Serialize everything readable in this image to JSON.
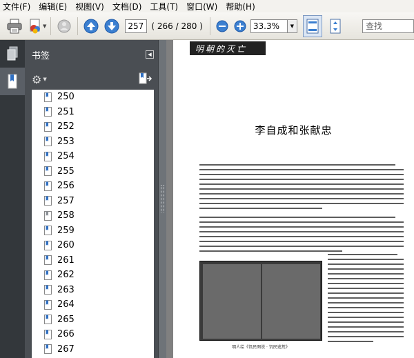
{
  "menu": [
    "文件(F)",
    "编辑(E)",
    "视图(V)",
    "文档(D)",
    "工具(T)",
    "窗口(W)",
    "帮助(H)"
  ],
  "toolbar": {
    "print_icon": "printer-icon",
    "current_page": "257",
    "page_count": "( 266 / 280 )",
    "zoom": "33.3%",
    "search_placeholder": "查找"
  },
  "bookmarks_panel": {
    "title": "书签",
    "items": [
      "250",
      "251",
      "252",
      "253",
      "254",
      "255",
      "256",
      "257",
      "258",
      "259",
      "260",
      "261",
      "262",
      "263",
      "264",
      "265",
      "266",
      "267"
    ],
    "selected_index": 8
  },
  "document": {
    "header_band": "明朝的灭亡",
    "chapter_title": "李自成和张献忠",
    "caption": "明人绘《饥民图说 · 饥民逃荒》"
  },
  "colors": {
    "accent": "#2f6fc2",
    "panel_bg": "#4a4e53",
    "nav_bg": "#33373b",
    "doc_bg": "#808080"
  }
}
